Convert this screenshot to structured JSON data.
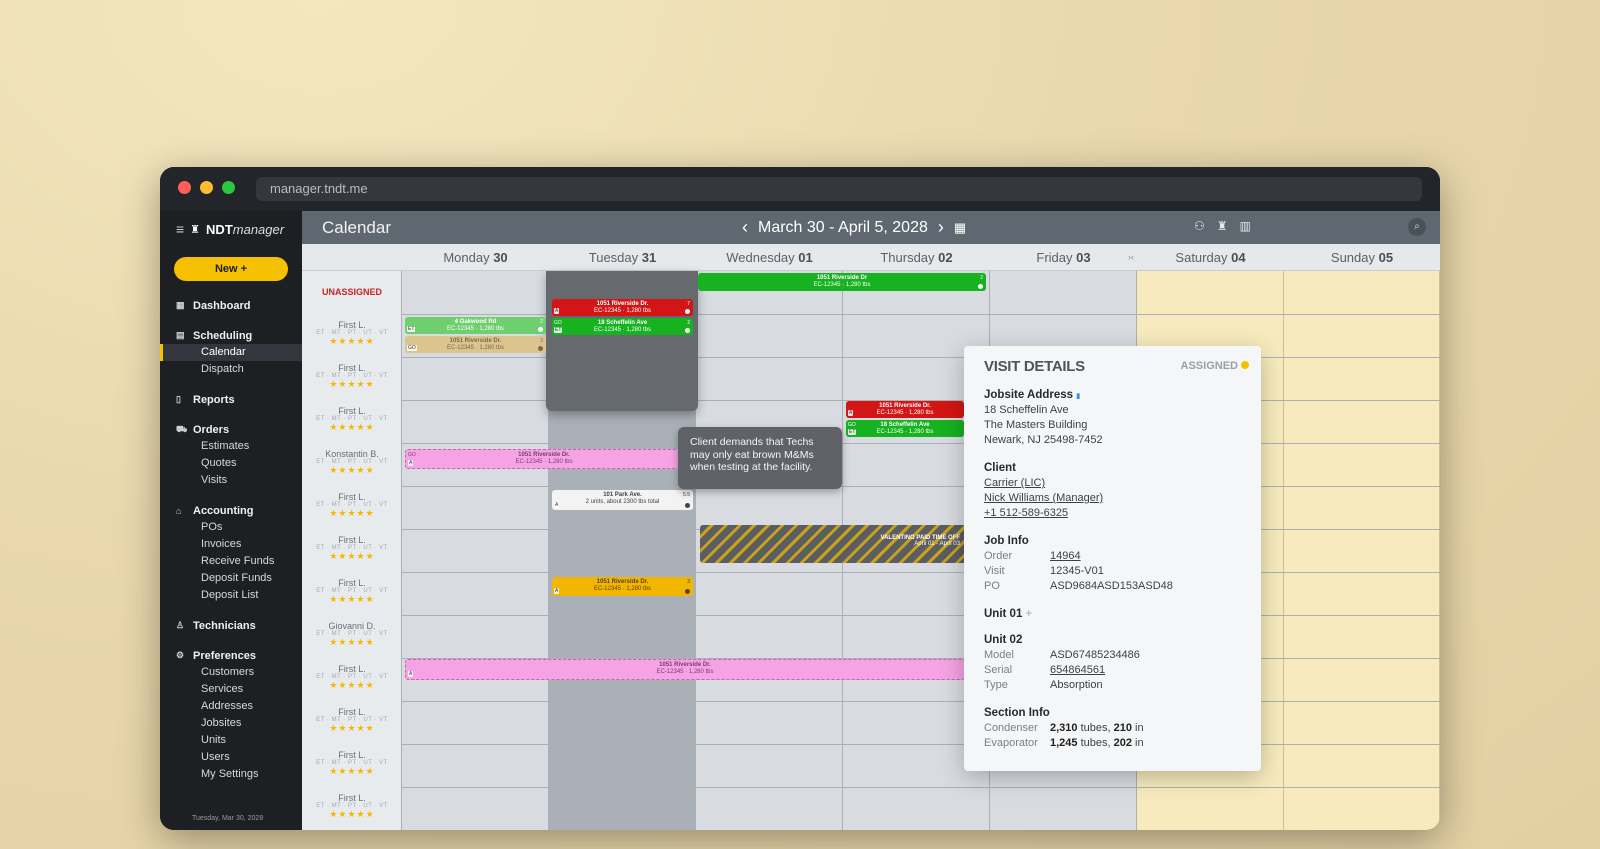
{
  "browser": {
    "url": "manager.tndt.me"
  },
  "brand": {
    "bold": "NDT",
    "italic": "manager"
  },
  "sidebar": {
    "new_button": "New +",
    "sections": [
      {
        "label": "Dashboard",
        "icon": "dashboard-icon",
        "items": []
      },
      {
        "label": "Scheduling",
        "icon": "calendar-icon",
        "items": [
          "Calendar",
          "Dispatch"
        ]
      },
      {
        "label": "Reports",
        "icon": "document-icon",
        "items": []
      },
      {
        "label": "Orders",
        "icon": "cart-icon",
        "items": [
          "Estimates",
          "Quotes",
          "Visits"
        ]
      },
      {
        "label": "Accounting",
        "icon": "bank-icon",
        "items": [
          "POs",
          "Invoices",
          "Receive Funds",
          "Deposit Funds",
          "Deposit List"
        ]
      },
      {
        "label": "Technicians",
        "icon": "person-icon",
        "items": []
      },
      {
        "label": "Preferences",
        "icon": "gear-icon",
        "items": [
          "Customers",
          "Services",
          "Addresses",
          "Jobsites",
          "Units",
          "Users",
          "My Settings"
        ]
      }
    ],
    "active_item": "Calendar",
    "footer_date": "Tuesday, Mar 30, 2028"
  },
  "header": {
    "title": "Calendar",
    "date_range": "March 30 - April 5, 2028"
  },
  "days": [
    {
      "name": "Monday",
      "num": "30"
    },
    {
      "name": "Tuesday",
      "num": "31"
    },
    {
      "name": "Wednesday",
      "num": "01"
    },
    {
      "name": "Thursday",
      "num": "02"
    },
    {
      "name": "Friday",
      "num": "03"
    },
    {
      "name": "Saturday",
      "num": "04"
    },
    {
      "name": "Sunday",
      "num": "05"
    }
  ],
  "unassigned_label": "UNASSIGNED",
  "technicians": [
    {
      "name": "First L.",
      "days": "ET · MT · PT · UT · VT",
      "stars": "★★★★★"
    },
    {
      "name": "First L.",
      "days": "ET · MT · PT · UT · VT",
      "stars": "★★★★★"
    },
    {
      "name": "First L.",
      "days": "ET · MT · PT · UT · VT",
      "stars": "★★★★★"
    },
    {
      "name": "Konstantin B.",
      "days": "ET · MT · PT · UT · VT",
      "stars": "★★★★★"
    },
    {
      "name": "First L.",
      "days": "ET · MT · PT · UT · VT",
      "stars": "★★★★★"
    },
    {
      "name": "First L.",
      "days": "ET · MT · PT · UT · VT",
      "stars": "★★★★★"
    },
    {
      "name": "First L.",
      "days": "ET · MT · PT · UT · VT",
      "stars": "★★★★★"
    },
    {
      "name": "Giovanni D.",
      "days": "ET · MT · PT · UT · VT",
      "stars": "★★★★★"
    },
    {
      "name": "First L.",
      "days": "ET · MT · PT · UT · VT",
      "stars": "★★★★★"
    },
    {
      "name": "First L.",
      "days": "ET · MT · PT · UT · VT",
      "stars": "★★★★★"
    },
    {
      "name": "First L.",
      "days": "ET · MT · PT · UT · VT",
      "stars": "★★★★★"
    },
    {
      "name": "First L.",
      "days": "ET · MT · PT · UT · VT",
      "stars": "★★★★★"
    }
  ],
  "events": {
    "e1": {
      "title": "1051 Riverside Dr",
      "sub": "EC-12345 · 1,280 tbs",
      "num": "2"
    },
    "e2": {
      "title": "1051 Riverside Dr.",
      "sub": "EC-12345 · 1,280 tbs",
      "num": "7"
    },
    "e3": {
      "title": "18 Scheffelin Ave",
      "sub": "EC-12345 · 1,280 tbs",
      "num": "2"
    },
    "e4": {
      "title": "4 Oakwood Rd",
      "sub": "EC-12345 · 1,280 tbs",
      "num": "2"
    },
    "e5": {
      "title": "1051 Riverside Dr.",
      "sub": "EC-12345 · 1,280 tbs",
      "num": "3"
    },
    "e6": {
      "title": "1051 Riverside Dr.",
      "sub": "EC-12345 · 1,280 tbs"
    },
    "e7": {
      "title": "18 Scheffelin Ave",
      "sub": "EC-12345 · 1,280 tbs"
    },
    "e8": {
      "title": "1051 Riverside Dr.",
      "sub": "EC-12345 · 1,280 tbs"
    },
    "e9": {
      "title": "101 Park Ave.",
      "sub": "2 units, about 2300 tbs total",
      "num": "5.5"
    },
    "e10": {
      "title": "1051 Riverside Dr.",
      "sub": "EC-12345 · 1,280 tbs",
      "num": "3"
    },
    "e11": {
      "title": "1051 Riverside Dr.",
      "sub": "EC-12345 · 1,280 tbs"
    }
  },
  "timeoff": {
    "title": "VALENTINO PAID TIME OFF",
    "sub": "April 01 - April 03"
  },
  "tooltip": "Client demands that Techs may only eat brown M&Ms when testing at the facility.",
  "details": {
    "heading": "VISIT DETAILS",
    "status": "ASSIGNED",
    "status_color": "#f5c000",
    "jobsite_label": "Jobsite Address",
    "jobsite": [
      "18 Scheffelin Ave",
      "The Masters Building",
      "Newark, NJ 25498-7452"
    ],
    "client_label": "Client",
    "client": [
      "Carrier (LIC)",
      "Nick Williams (Manager)",
      "+1 512-589-6325"
    ],
    "job_label": "Job Info",
    "job": [
      {
        "k": "Order",
        "v": "14964"
      },
      {
        "k": "Visit",
        "v": "12345-V01"
      },
      {
        "k": "PO",
        "v": "ASD9684ASD153ASD48"
      }
    ],
    "unit1_label": "Unit 01",
    "unit2_label": "Unit 02",
    "unit2": [
      {
        "k": "Model",
        "v": "ASD67485234486"
      },
      {
        "k": "Serial",
        "v": "654864561"
      },
      {
        "k": "Type",
        "v": "Absorption"
      }
    ],
    "section_label": "Section Info",
    "section": {
      "condenser": {
        "k": "Condenser",
        "tubes": "2,310",
        "tubes_unit": "tubes,",
        "len": "210",
        "len_unit": "in"
      },
      "evaporator": {
        "k": "Evaporator",
        "tubes": "1,245",
        "tubes_unit": "tubes,",
        "len": "202",
        "len_unit": "in"
      }
    }
  }
}
